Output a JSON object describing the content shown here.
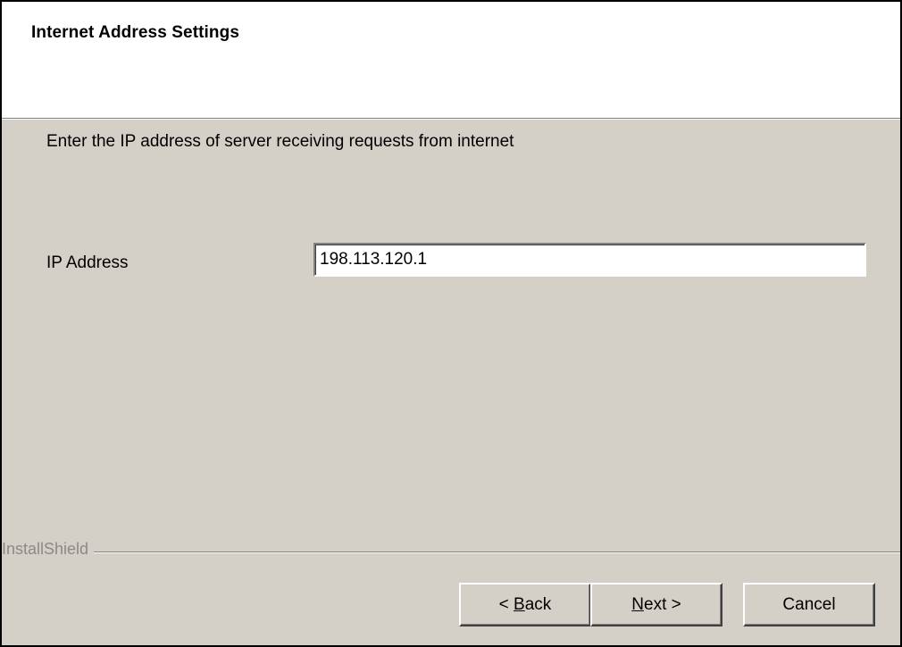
{
  "dialog": {
    "title": "Internet Address Settings",
    "instruction": "Enter the IP address of server receiving requests from internet",
    "ip_label": "IP Address",
    "ip_value": "198.113.120.1",
    "brand": "InstallShield"
  },
  "buttons": {
    "back": {
      "prefix": "< ",
      "accel": "B",
      "rest": "ack"
    },
    "next": {
      "prefix": "",
      "accel": "N",
      "rest": "ext >"
    },
    "cancel": "Cancel"
  }
}
